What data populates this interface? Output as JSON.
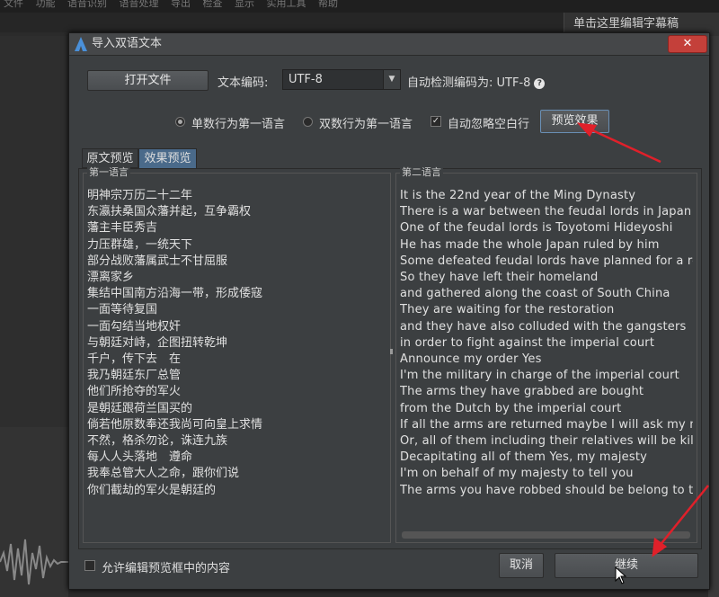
{
  "background": {
    "menubar": [
      "文件",
      "功能",
      "语音识别",
      "语音处理",
      "导出",
      "检查",
      "显示",
      "实用工具",
      "帮助"
    ],
    "subtitle_hint": "单击这里编辑字幕稿"
  },
  "dialog": {
    "title": "导入双语文本",
    "close_symbol": "✕",
    "open_file_label": "打开文件",
    "encoding_label": "文本编码:",
    "encoding_value": "UTF-8",
    "detected_label": "自动检测编码为: UTF-8",
    "help_symbol": "?",
    "options": {
      "odd_first": "单数行为第一语言",
      "even_first": "双数行为第一语言",
      "ignore_blank": "自动忽略空白行",
      "odd_first_selected": true,
      "even_first_selected": false,
      "ignore_blank_checked": true
    },
    "preview_button_label": "预览效果",
    "tabs": [
      "原文预览",
      "效果预览"
    ],
    "active_tab": "效果预览",
    "first_language": {
      "legend": "第一语言",
      "lines": [
        "明神宗万历二十二年",
        "东瀛扶桑国众藩并起，互争霸权",
        "藩主丰臣秀吉",
        "力压群雄，一统天下",
        "部分战败藩属武士不甘屈服",
        "漂离家乡",
        "集结中国南方沿海一带，形成倭寇",
        "一面等待复国",
        "一面勾结当地权奸",
        "与朝廷对峙，企图扭转乾坤",
        "千户，传下去　在",
        "我乃朝廷东厂总管",
        "他们所抢夺的军火",
        "是朝廷跟荷兰国买的",
        "倘若他原数奉还我尚可向皇上求情",
        "不然，格杀勿论，诛连九族",
        "每人人头落地　遵命",
        "我奉总管大人之命，跟你们说",
        "你们截劫的军火是朝廷的"
      ]
    },
    "second_language": {
      "legend": "第二语言",
      "lines": [
        "It is the 22nd year of the Ming Dynasty",
        "There is a war between the feudal lords in Japan",
        "One of the feudal lords is Toyotomi Hideyoshi",
        "He has made the whole Japan ruled by him",
        "Some defeated feudal lords have planned for a reb",
        "So they have left their homeland",
        "and gathered along the coast of South China",
        "They are waiting for the restoration",
        "and they have also colluded with the gangsters",
        "in order to fight against the imperial court",
        "Announce my order Yes",
        "I'm the military in charge of the imperial court",
        "The arms they have grabbed are bought",
        "from the Dutch by the imperial court",
        "If all the arms are returned maybe I will ask my ma",
        "Or, all of them including their relatives will be kille",
        "Decapitating all of them Yes, my majesty",
        "I'm on behalf of my majesty to tell you",
        "The arms you have robbed should be belong to th"
      ]
    },
    "allow_edit_label": "允许编辑预览框中的内容",
    "cancel_label": "取消",
    "continue_label": "继续"
  },
  "colors": {
    "dialog_bg": "#3c3f41",
    "active_tab": "#4a6a8a",
    "close_button": "#c4403a",
    "annotation_arrow": "#e0202a"
  }
}
